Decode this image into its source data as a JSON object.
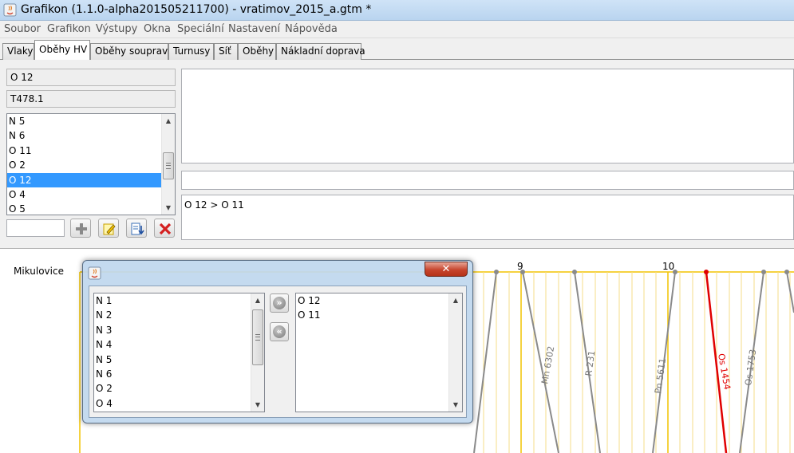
{
  "window": {
    "title": "Grafikon (1.1.0-alpha201505211700) - vratimov_2015_a.gtm *"
  },
  "menu": [
    "Soubor",
    "Grafikon",
    "Výstupy",
    "Okna",
    "Speciální",
    "Nastavení",
    "Nápověda"
  ],
  "tabs": [
    {
      "label": "Vlaky",
      "active": false
    },
    {
      "label": "Oběhy HV",
      "active": true
    },
    {
      "label": "Oběhy souprav",
      "active": false
    },
    {
      "label": "Turnusy",
      "active": false
    },
    {
      "label": "Síť",
      "active": false
    },
    {
      "label": "Oběhy",
      "active": false
    },
    {
      "label": "Nákladní doprava",
      "active": false
    }
  ],
  "circulation": {
    "name": "O 12",
    "type": "T478.1",
    "list": [
      "N 5",
      "N 6",
      "O 11",
      "O 2",
      "O 12",
      "O 4",
      "O 5"
    ],
    "selected": "O 12",
    "new_name": "",
    "sequence_text": "O 12 > O 11"
  },
  "toolbar_icons": [
    "plus-icon",
    "edit-icon",
    "import-icon",
    "delete-icon"
  ],
  "graph": {
    "station": "Mikulovice",
    "hours": [
      {
        "label": "9",
        "value": 9
      },
      {
        "label": "10",
        "value": 10
      }
    ],
    "trains": [
      {
        "label": "Mn 6302",
        "color": "#8a8a8a"
      },
      {
        "label": "R 231",
        "color": "#8a8a8a"
      },
      {
        "label": "Pn 5611",
        "color": "#8a8a8a"
      },
      {
        "label": "Os 1454",
        "color": "#e00000"
      },
      {
        "label": "Os 1753",
        "color": "#8a8a8a"
      }
    ],
    "colors": {
      "grid": "#f2c400",
      "grid_minor": "#f6de88",
      "train": "#8a8a8a",
      "highlight": "#e00000"
    }
  },
  "dialog": {
    "left_list": [
      "N 1",
      "N 2",
      "N 3",
      "N 4",
      "N 5",
      "N 6",
      "O 2",
      "O 4"
    ],
    "right_list": [
      "O 12",
      "O 11"
    ],
    "add_icon": "double-chevron-right-icon",
    "remove_icon": "double-chevron-left-icon",
    "add_glyph": "»",
    "remove_glyph": "«",
    "close_glyph": "✕"
  }
}
